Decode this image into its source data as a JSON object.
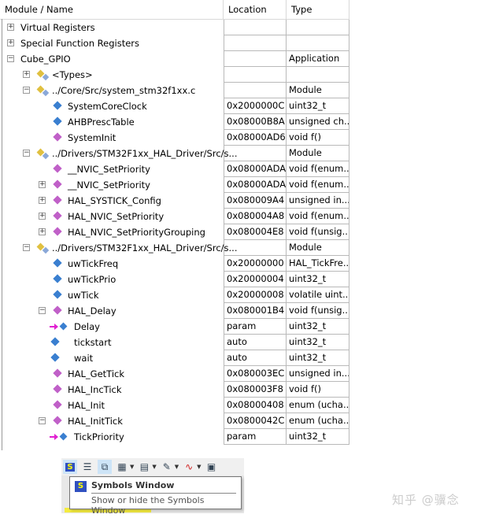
{
  "columns": {
    "name": "Module / Name",
    "location": "Location",
    "type": "Type"
  },
  "rows": [
    {
      "level": 0,
      "exp": "plus",
      "icon": "none",
      "name": "Virtual Registers",
      "loc": "",
      "type": ""
    },
    {
      "level": 0,
      "exp": "plus",
      "icon": "none",
      "name": "Special Function Registers",
      "loc": "",
      "type": ""
    },
    {
      "level": 0,
      "exp": "minus",
      "icon": "none",
      "name": "Cube_GPIO",
      "loc": "",
      "type": "Application"
    },
    {
      "level": 1,
      "exp": "plus",
      "icon": "module",
      "name": "<Types>",
      "loc": "",
      "type": ""
    },
    {
      "level": 1,
      "exp": "minus",
      "icon": "module",
      "name": "../Core/Src/system_stm32f1xx.c",
      "loc": "",
      "type": "Module"
    },
    {
      "level": 2,
      "exp": "none",
      "icon": "variable",
      "name": "SystemCoreClock",
      "loc": "0x2000000C",
      "type": "uint32_t"
    },
    {
      "level": 2,
      "exp": "none",
      "icon": "variable",
      "name": "AHBPrescTable",
      "loc": "0x08000B8A",
      "type": "unsigned ch..."
    },
    {
      "level": 2,
      "exp": "none",
      "icon": "function",
      "name": "SystemInit",
      "loc": "0x08000AD6",
      "type": "void f()"
    },
    {
      "level": 1,
      "exp": "minus",
      "icon": "module",
      "name": "../Drivers/STM32F1xx_HAL_Driver/Src/s...",
      "loc": "",
      "type": "Module"
    },
    {
      "level": 2,
      "exp": "none",
      "icon": "function",
      "name": "__NVIC_SetPriority",
      "loc": "0x08000ADA",
      "type": "void f(enum..."
    },
    {
      "level": 2,
      "exp": "plus",
      "icon": "function",
      "name": "__NVIC_SetPriority",
      "loc": "0x08000ADA",
      "type": "void f(enum..."
    },
    {
      "level": 2,
      "exp": "plus",
      "icon": "function",
      "name": "HAL_SYSTICK_Config",
      "loc": "0x080009A4",
      "type": "unsigned in..."
    },
    {
      "level": 2,
      "exp": "plus",
      "icon": "function",
      "name": "HAL_NVIC_SetPriority",
      "loc": "0x080004A8",
      "type": "void f(enum..."
    },
    {
      "level": 2,
      "exp": "plus",
      "icon": "function",
      "name": "HAL_NVIC_SetPriorityGrouping",
      "loc": "0x080004E8",
      "type": "void f(unsig..."
    },
    {
      "level": 1,
      "exp": "minus",
      "icon": "module",
      "name": "../Drivers/STM32F1xx_HAL_Driver/Src/s...",
      "loc": "",
      "type": "Module"
    },
    {
      "level": 2,
      "exp": "none",
      "icon": "variable",
      "name": "uwTickFreq",
      "loc": "0x20000000",
      "type": "HAL_TickFre..."
    },
    {
      "level": 2,
      "exp": "none",
      "icon": "variable",
      "name": "uwTickPrio",
      "loc": "0x20000004",
      "type": "uint32_t"
    },
    {
      "level": 2,
      "exp": "none",
      "icon": "variable",
      "name": "uwTick",
      "loc": "0x20000008",
      "type": "volatile uint..."
    },
    {
      "level": 2,
      "exp": "minus",
      "icon": "function",
      "name": "HAL_Delay",
      "loc": "0x080001B4",
      "type": "void f(unsig..."
    },
    {
      "level": 3,
      "exp": "none",
      "icon": "param",
      "name": "Delay",
      "loc": "param",
      "type": "uint32_t"
    },
    {
      "level": 3,
      "exp": "none",
      "icon": "variable",
      "name": "tickstart",
      "loc": "auto",
      "type": "uint32_t"
    },
    {
      "level": 3,
      "exp": "none",
      "icon": "variable",
      "name": "wait",
      "loc": "auto",
      "type": "uint32_t"
    },
    {
      "level": 2,
      "exp": "none",
      "icon": "function",
      "name": "HAL_GetTick",
      "loc": "0x080003EC",
      "type": "unsigned in..."
    },
    {
      "level": 2,
      "exp": "none",
      "icon": "function",
      "name": "HAL_IncTick",
      "loc": "0x080003F8",
      "type": "void f()"
    },
    {
      "level": 2,
      "exp": "none",
      "icon": "function",
      "name": "HAL_Init",
      "loc": "0x08000408",
      "type": "enum (ucha..."
    },
    {
      "level": 2,
      "exp": "minus",
      "icon": "function",
      "name": "HAL_InitTick",
      "loc": "0x0800042C",
      "type": "enum (ucha..."
    },
    {
      "level": 3,
      "exp": "none",
      "icon": "param",
      "name": "TickPriority",
      "loc": "param",
      "type": "uint32_t"
    }
  ],
  "tooltip": {
    "title": "Symbols Window",
    "description": "Show or hide the Symbols Window"
  },
  "watermark": "知乎 @骥念",
  "colors": {
    "variable": "#3a7fd0",
    "function": "#c060c8",
    "module": "#e0c040",
    "param_arrow": "#e020d0"
  }
}
